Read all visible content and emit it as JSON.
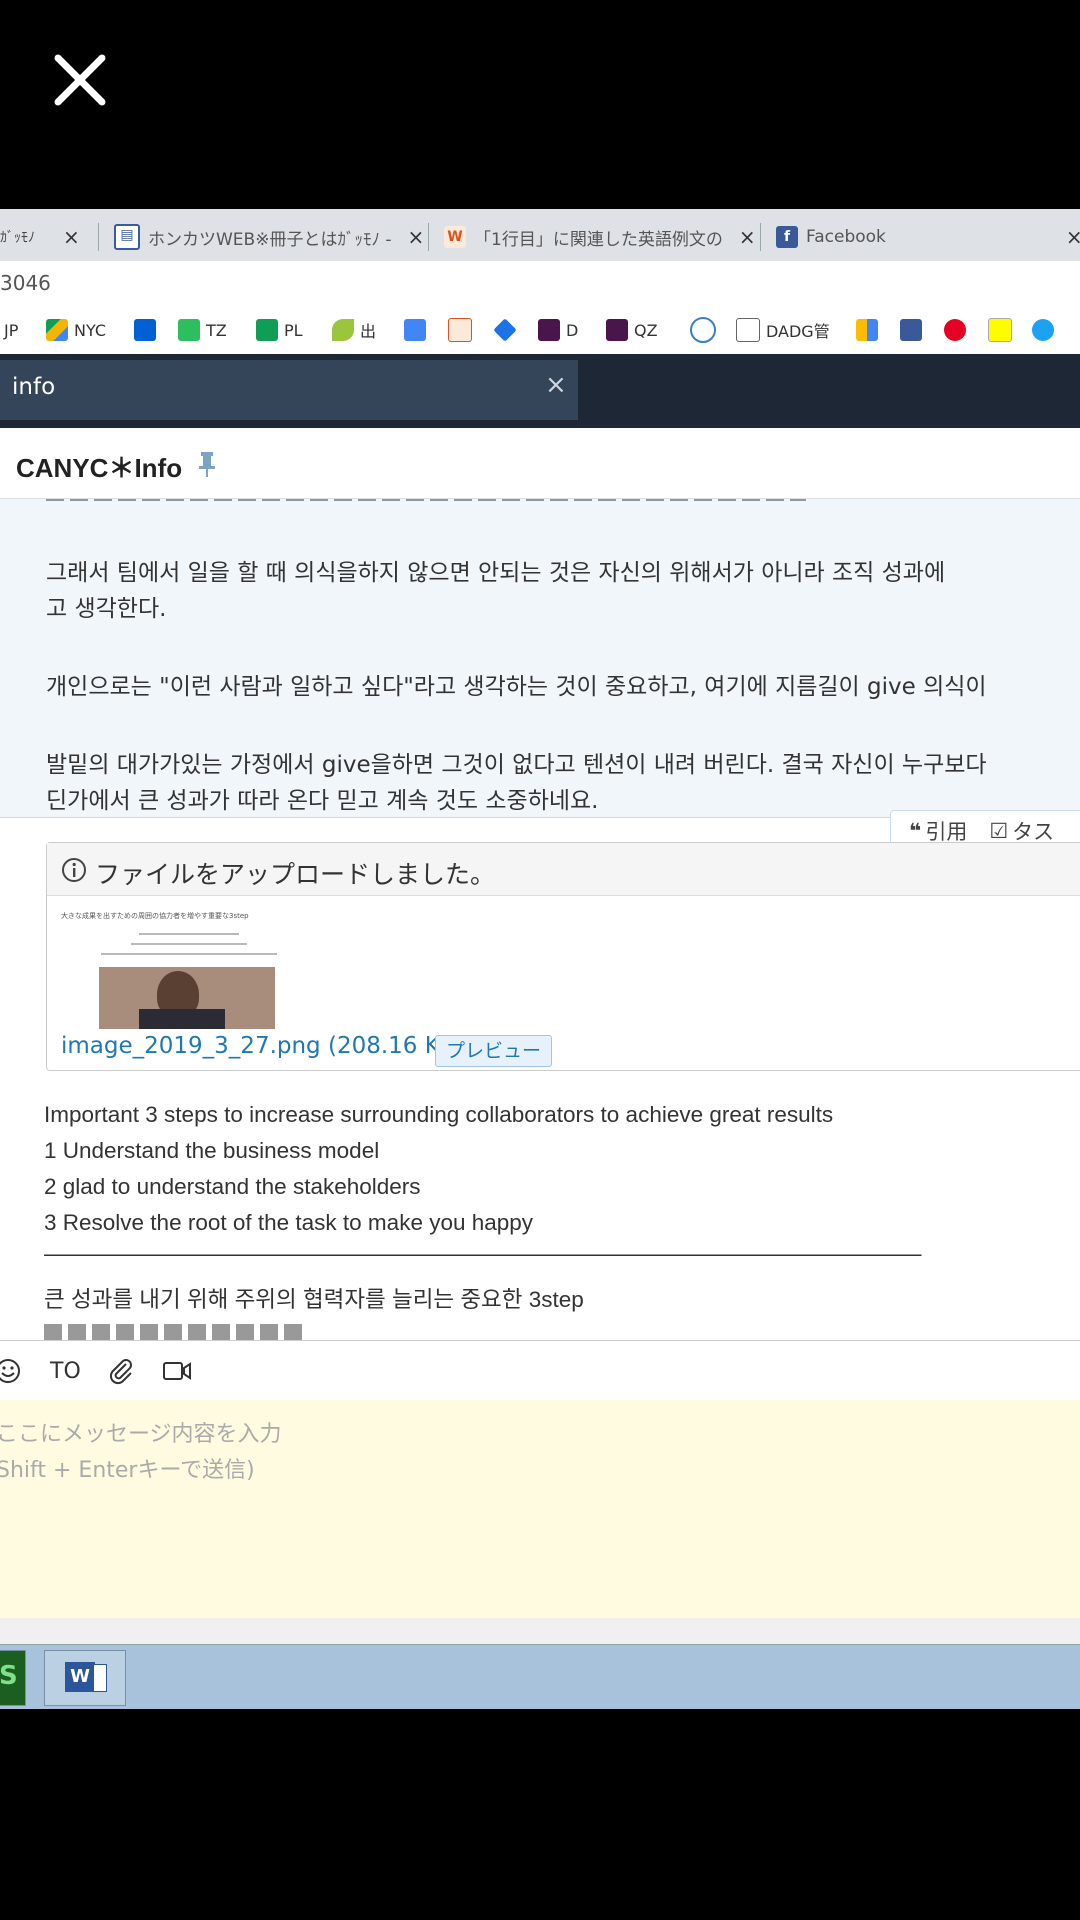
{
  "viewer": {
    "close_icon": "close-icon"
  },
  "browser": {
    "tabs": [
      {
        "label": "ｶﾞｯﾓﾉ",
        "close": "×"
      },
      {
        "label": "ホンカツWEB※冊子とはｶﾞｯﾓﾉ -",
        "close": "×",
        "icon": "form-icon"
      },
      {
        "label": "「1行目」に関連した英語例文の",
        "close": "×",
        "icon": "weblio-icon"
      },
      {
        "label": "Facebook",
        "close": "×",
        "icon": "facebook-icon"
      }
    ],
    "address": "3046",
    "bookmarks": [
      {
        "label": "JP",
        "icon": "none"
      },
      {
        "label": "NYC",
        "icon": "google-drive-icon"
      },
      {
        "label": "",
        "icon": "box-icon"
      },
      {
        "label": "TZ",
        "icon": "evernote-icon"
      },
      {
        "label": "PL",
        "icon": "sheets-icon"
      },
      {
        "label": "出",
        "icon": "leaf-icon"
      },
      {
        "label": "",
        "icon": "translate-icon"
      },
      {
        "label": "",
        "icon": "weblio-icon"
      },
      {
        "label": "",
        "icon": "diamond-icon"
      },
      {
        "label": "D",
        "icon": "slack-icon"
      },
      {
        "label": "QZ",
        "icon": "slack-icon"
      },
      {
        "label": "",
        "icon": "wordpress-icon"
      },
      {
        "label": "DADG管",
        "icon": "page-icon"
      },
      {
        "label": "",
        "icon": "google-ads-icon"
      },
      {
        "label": "",
        "icon": "facebook-icon"
      },
      {
        "label": "",
        "icon": "pinterest-icon"
      },
      {
        "label": "",
        "icon": "snapchat-icon"
      },
      {
        "label": "",
        "icon": "twitter-icon"
      }
    ]
  },
  "chatwork": {
    "room_tab": {
      "label": "info",
      "close": "×"
    },
    "room_title": "CANYC＊Info",
    "pin_icon": "pin-icon",
    "korean_lines": [
      "  그래서 팀에서 일을 할 때 의식을하지 않으면 안되는 것은 자신의 위해서가 아니라 조직 성과에",
      "고 생각한다.",
      "개인으로는 \"이런 사람과 일하고 싶다\"라고 생각하는 것이 중요하고, 여기에 지름길이 give 의식이",
      "발밑의 대가가있는 가정에서 give을하면 그것이 없다고 텐션이 내려 버린다. 결국 자신이 누구보다",
      "딘가에서 큰 성과가 따라 온다 믿고 계속 것도 소중하네요."
    ],
    "actions": {
      "quote": "引用",
      "task": "タス"
    },
    "file": {
      "header": "ファイルをアップロードしました。",
      "thumb_title": "大きな成果を出すための周囲の協力者を増やす重要な3step",
      "link": "image_2019_3_27.png (208.16 KB)",
      "preview": "プレビュー"
    },
    "english_lines": [
      "Important 3 steps to increase surrounding collaborators to achieve great results",
      "1 Understand the business model",
      "2 glad to understand the stakeholders",
      "3 Resolve the root of the task to make you happy",
      "———————————————————————————————————————",
      "큰 성과를 내기 위해 주위의 협력자를 늘리는 중요한 3step"
    ],
    "toolbar": {
      "to": "TO"
    },
    "input": {
      "placeholder_1": "ここにメッセージ内容を入力",
      "placeholder_2": "Shift + Enterキーで送信)"
    }
  },
  "colors": {
    "dark": "#1d2735",
    "accent": "#1f77b4",
    "input_bg": "#fffbe0",
    "taskbar": "#a9c2db"
  }
}
